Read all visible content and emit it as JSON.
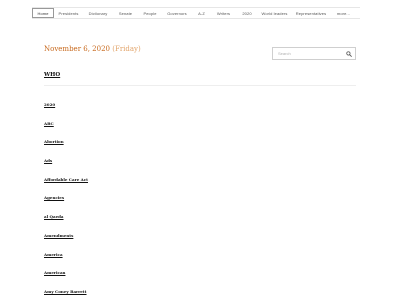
{
  "nav": {
    "items": [
      {
        "label": "Home",
        "active": true
      },
      {
        "label": "Presidents",
        "active": false
      },
      {
        "label": "Dictionary",
        "active": false
      },
      {
        "label": "Senate",
        "active": false
      },
      {
        "label": "People",
        "active": false
      },
      {
        "label": "Governors",
        "active": false
      },
      {
        "label": "A-Z",
        "active": false
      },
      {
        "label": "Writers",
        "active": false
      },
      {
        "label": "2020",
        "active": false
      },
      {
        "label": "World leaders",
        "active": false
      },
      {
        "label": "Representatives",
        "active": false
      },
      {
        "label": "more...",
        "active": false
      }
    ]
  },
  "header": {
    "date": "November 6, 2020",
    "weekday": "(Friday)"
  },
  "search": {
    "placeholder": "Search",
    "icon": "search-icon"
  },
  "main": {
    "heading": "WHO",
    "links": [
      "2020",
      "ABC",
      "Abortion",
      "Ads",
      "Affordable Care Act",
      "Agencies",
      "al Qaeda",
      "Amendments",
      "America",
      "American",
      "Amy Coney Barrett"
    ]
  },
  "colors": {
    "date": "#c86a1e",
    "weekday": "#e2a46a",
    "link": "#111111"
  }
}
